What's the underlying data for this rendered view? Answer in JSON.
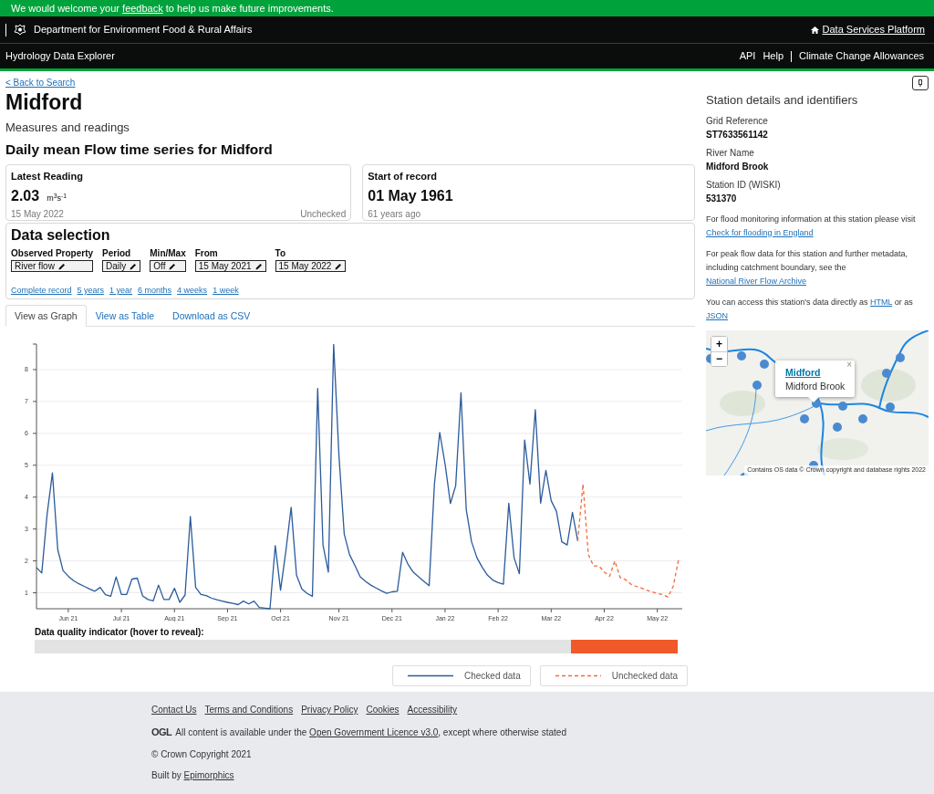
{
  "feedback_banner": {
    "parts": [
      {
        "text": "We would welcome your "
      },
      {
        "link": "feedback"
      },
      {
        "text": " to help us make future improvements."
      }
    ]
  },
  "header": {
    "department": "Department for Environment Food & Rural Affairs",
    "platform_link": "Data Services Platform",
    "app_title": "Hydrology Data Explorer",
    "nav": [
      {
        "label": "API"
      },
      {
        "label": "Help"
      },
      {
        "label": "Climate Change Allowances"
      }
    ]
  },
  "back_link": "< Back to Search",
  "title": "Midford",
  "subtitle": "Measures and readings",
  "series_title": "Daily mean Flow time series for Midford",
  "latest_reading": {
    "heading": "Latest Reading",
    "value": "2.03",
    "unit": "m$^{3}$s$^{-1}$",
    "date": "15 May 2022",
    "status": "Unchecked"
  },
  "start_of_record": {
    "heading": "Start of record",
    "value": "01 May 1961",
    "note": "61 years ago"
  },
  "data_selection": {
    "heading": "Data selection",
    "fields": [
      {
        "label": "Observed Property",
        "value": "River flow"
      },
      {
        "label": "Period",
        "value": "Daily"
      },
      {
        "label": "Min/Max",
        "value": "Off"
      },
      {
        "label": "From",
        "value": "15 May 2021"
      },
      {
        "label": "To",
        "value": "15 May 2022"
      }
    ],
    "quick_links": [
      "Complete record",
      "5 years",
      "1 year",
      "6 months",
      "4 weeks",
      "1 week"
    ]
  },
  "tabs": [
    {
      "label": "View as Graph",
      "selected": true
    },
    {
      "label": "View as Table",
      "selected": false
    },
    {
      "label": "Download as CSV",
      "selected": false
    }
  ],
  "chart_data": {
    "type": "line",
    "grid": true,
    "ylim": [
      0.5,
      8.8
    ],
    "yticks": [
      1,
      2,
      3,
      4,
      5,
      6,
      7,
      8
    ],
    "categories": [
      null,
      null,
      null,
      null,
      null,
      null,
      "Jun 21",
      null,
      null,
      null,
      null,
      null,
      null,
      null,
      null,
      null,
      "Jul 21",
      null,
      null,
      null,
      null,
      null,
      null,
      null,
      null,
      null,
      "Aug 21",
      null,
      null,
      null,
      null,
      null,
      null,
      null,
      null,
      null,
      "Sep 21",
      null,
      null,
      null,
      null,
      null,
      null,
      null,
      null,
      null,
      "Oct 21",
      null,
      null,
      null,
      null,
      null,
      null,
      null,
      null,
      null,
      null,
      "Nov 21",
      null,
      null,
      null,
      null,
      null,
      null,
      null,
      null,
      null,
      "Dec 21",
      null,
      null,
      null,
      null,
      null,
      null,
      null,
      null,
      null,
      "Jan 22",
      null,
      null,
      null,
      null,
      null,
      null,
      null,
      null,
      null,
      "Feb 22",
      null,
      null,
      null,
      null,
      null,
      null,
      null,
      null,
      null,
      "Mar 22",
      null,
      null,
      null,
      null,
      null,
      null,
      null,
      null,
      null,
      "Apr 22",
      null,
      null,
      null,
      null,
      null,
      null,
      null,
      null,
      null,
      "May 22",
      null,
      null,
      null,
      null
    ],
    "series": [
      {
        "name": "Checked data",
        "color": "#2b5b9c",
        "line_style": "solid",
        "values": [
          1.79,
          1.62,
          3.45,
          4.76,
          2.36,
          1.7,
          1.52,
          1.38,
          1.28,
          1.2,
          1.12,
          1.05,
          1.17,
          0.94,
          0.89,
          1.5,
          0.95,
          0.95,
          1.43,
          1.46,
          0.9,
          0.79,
          0.75,
          1.24,
          0.79,
          0.79,
          1.14,
          0.7,
          0.93,
          3.39,
          1.17,
          0.95,
          0.91,
          0.83,
          0.78,
          0.74,
          0.7,
          0.67,
          0.63,
          0.74,
          0.65,
          0.74,
          0.54,
          0.52,
          0.5,
          2.48,
          1.08,
          2.31,
          3.68,
          1.55,
          1.12,
          0.98,
          0.89,
          7.41,
          2.5,
          1.65,
          8.79,
          5.31,
          2.84,
          2.2,
          1.86,
          1.5,
          1.36,
          1.24,
          1.15,
          1.06,
          0.98,
          1.03,
          1.05,
          2.27,
          1.9,
          1.65,
          1.5,
          1.36,
          1.22,
          4.41,
          6.03,
          5.03,
          3.8,
          4.36,
          7.27,
          3.6,
          2.6,
          2.1,
          1.8,
          1.55,
          1.4,
          1.32,
          1.27,
          3.81,
          2.1,
          1.6,
          5.79,
          4.41,
          6.74,
          3.81,
          4.84,
          3.89,
          3.55,
          2.6,
          2.5,
          3.52,
          2.63,
          null,
          null,
          null,
          null,
          null,
          null,
          null,
          null,
          null,
          null,
          null,
          null,
          null,
          null,
          null,
          null,
          null,
          null,
          null
        ]
      },
      {
        "name": "Unchecked data",
        "color": "#f26b3a",
        "line_style": "dashed",
        "values": [
          null,
          null,
          null,
          null,
          null,
          null,
          null,
          null,
          null,
          null,
          null,
          null,
          null,
          null,
          null,
          null,
          null,
          null,
          null,
          null,
          null,
          null,
          null,
          null,
          null,
          null,
          null,
          null,
          null,
          null,
          null,
          null,
          null,
          null,
          null,
          null,
          null,
          null,
          null,
          null,
          null,
          null,
          null,
          null,
          null,
          null,
          null,
          null,
          null,
          null,
          null,
          null,
          null,
          null,
          null,
          null,
          null,
          null,
          null,
          null,
          null,
          null,
          null,
          null,
          null,
          null,
          null,
          null,
          null,
          null,
          null,
          null,
          null,
          null,
          null,
          null,
          null,
          null,
          null,
          null,
          null,
          null,
          null,
          null,
          null,
          null,
          null,
          null,
          null,
          null,
          null,
          null,
          null,
          null,
          null,
          null,
          null,
          null,
          null,
          null,
          null,
          null,
          2.63,
          4.41,
          2.2,
          1.84,
          1.84,
          1.65,
          1.52,
          2.0,
          1.48,
          1.41,
          1.27,
          1.2,
          1.15,
          1.08,
          1.03,
          0.98,
          0.94,
          0.87,
          1.2,
          2.03
        ]
      }
    ]
  },
  "quality": {
    "label": "Data quality indicator (hover to reveal):",
    "level": 0.834
  },
  "station": {
    "heading": "Station details and identifiers",
    "details": [
      {
        "label": "Grid Reference",
        "value": "ST7633561142"
      },
      {
        "label": "River Name",
        "value": "Midford Brook"
      },
      {
        "label": "Station ID (WISKI)",
        "value": "531370"
      }
    ],
    "paragraphs": [
      {
        "parts": [
          {
            "text": "For flood monitoring information at this station please visit "
          },
          {
            "link": "Check for flooding in England"
          }
        ]
      },
      {
        "parts": [
          {
            "text": "For peak flow data for this station and further metadata, including catchment boundary, see the "
          },
          {
            "link": "National River Flow Archive"
          }
        ]
      },
      {
        "parts": [
          {
            "text": "You can access this station's data directly as "
          },
          {
            "link": "HTML"
          },
          {
            "text": " or as "
          },
          {
            "link": "JSON"
          }
        ]
      }
    ]
  },
  "map": {
    "zoom_in": "+",
    "zoom_out": "−",
    "popup": {
      "title": "Midford",
      "subtitle": "Midford Brook",
      "close": "×"
    },
    "attribution": "Contains OS data © Crown copyright and database rights 2022"
  },
  "footer": {
    "links": [
      "Contact Us",
      "Terms and Conditions",
      "Privacy Policy",
      "Cookies",
      "Accessibility"
    ],
    "logo": "OGL",
    "licence": {
      "parts": [
        {
          "text": "All content is available under the "
        },
        {
          "link": "Open Government Licence v3.0"
        },
        {
          "text": ", except where otherwise stated"
        }
      ]
    },
    "copyright": "© Crown Copyright 2021",
    "built_by": {
      "parts": [
        {
          "text": "Built by "
        },
        {
          "link": "Epimorphics"
        }
      ]
    }
  }
}
